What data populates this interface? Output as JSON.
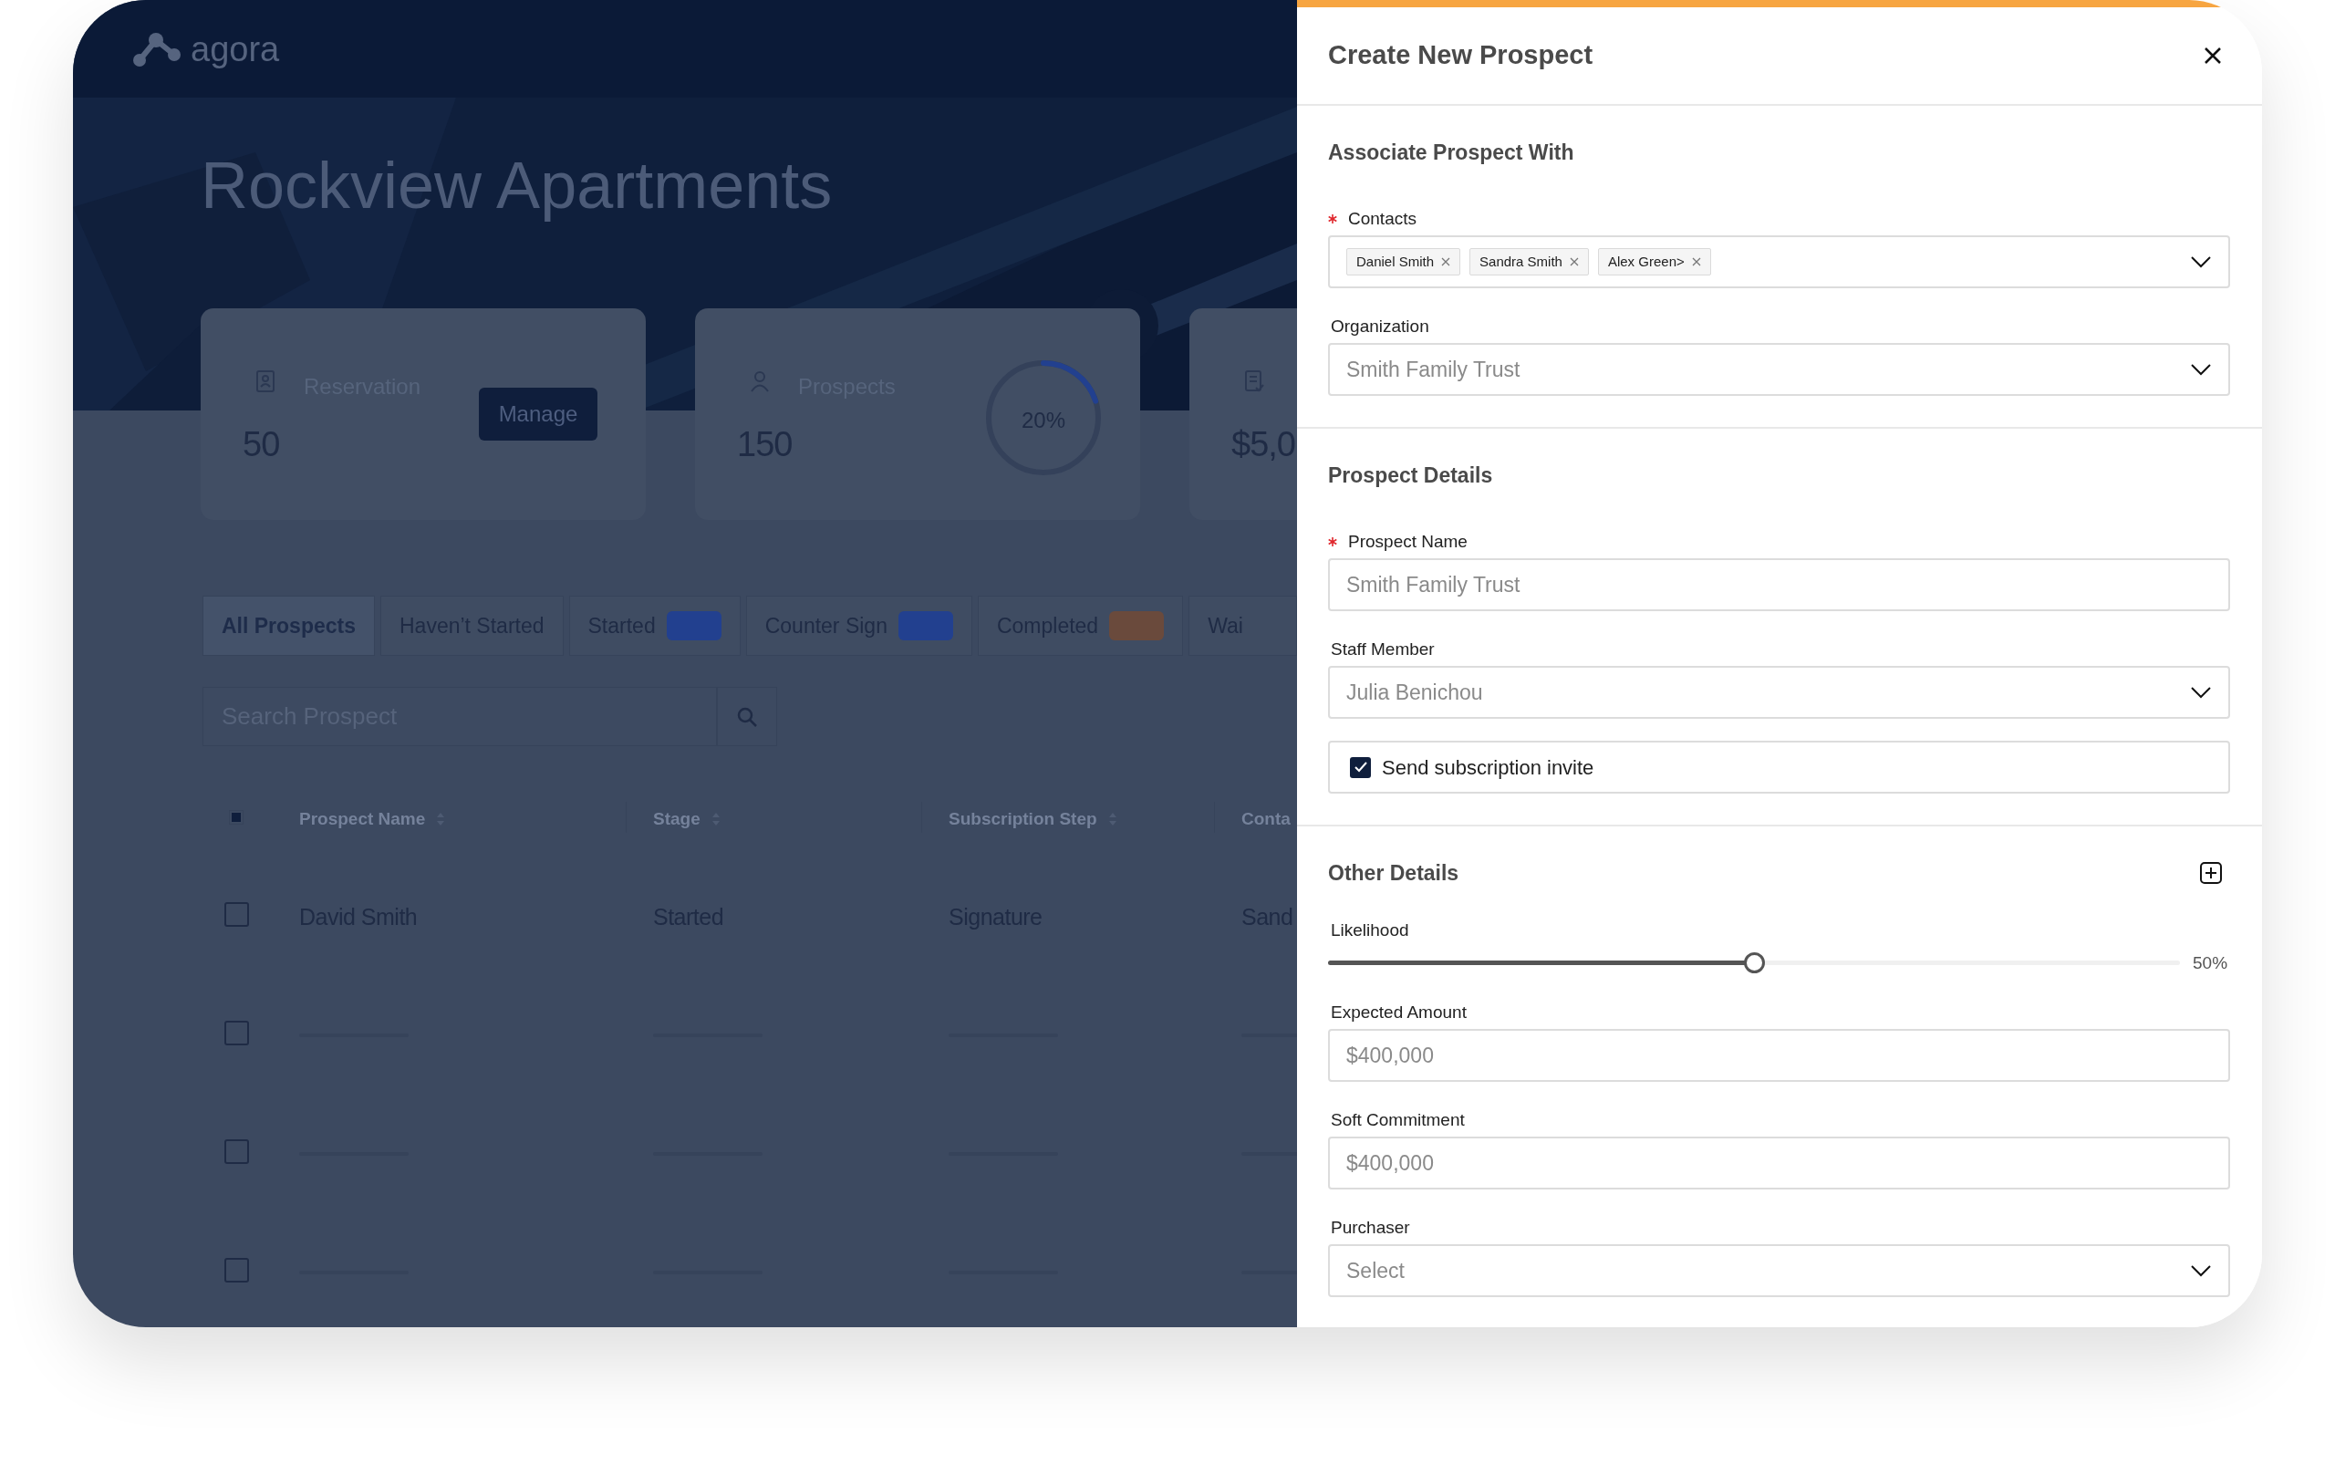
{
  "app": {
    "logo": "agora"
  },
  "hero": {
    "title": "Rockview Apartments"
  },
  "stat_cards": [
    {
      "kind": "button",
      "label": "Reservation",
      "value": "50",
      "button": "Manage"
    },
    {
      "kind": "ring",
      "label": "Prospects",
      "value": "150",
      "level": 0.2,
      "reading": "20%"
    },
    {
      "kind": "plain",
      "value": "$5,0"
    }
  ],
  "tabs": [
    {
      "label": "All Prospects",
      "selected": true
    },
    {
      "label": "Haven’t Started",
      "selected": false
    },
    {
      "label": "Started",
      "selected": false,
      "color": "#22408f"
    },
    {
      "label": "Counter Sign",
      "selected": false,
      "color": "#22408f"
    },
    {
      "label": "Completed",
      "selected": false,
      "color": "#6a4a3c"
    },
    {
      "label": "Wai",
      "selected": false
    }
  ],
  "search": {
    "placeholder": "Search Prospect"
  },
  "table": {
    "select_all": {
      "indeterminate": true
    },
    "columns": [
      "Prospect Name",
      "Stage",
      "Subscription Step",
      "Conta"
    ],
    "rows": [
      {
        "kind": "text",
        "checked": false,
        "cells": [
          "David Smith",
          "Started",
          "Signature",
          "Sand"
        ]
      },
      {
        "kind": "placeholder",
        "checked": false
      },
      {
        "kind": "placeholder",
        "checked": false
      },
      {
        "kind": "placeholder",
        "checked": false
      }
    ]
  },
  "panel": {
    "title": "Create New Prospect",
    "sections": [
      {
        "title": "Associate Prospect With",
        "fields": [
          {
            "kind": "tags",
            "label": "Contacts",
            "required": true,
            "tags": [
              "Daniel Smith",
              "Sandra Smith",
              "Alex Green>"
            ]
          },
          {
            "kind": "select",
            "label": "Organization",
            "required": false,
            "value": "Smith Family Trust"
          }
        ]
      },
      {
        "title": "Prospect Details",
        "fields": [
          {
            "kind": "text",
            "label": "Prospect Name",
            "required": true,
            "value": "Smith Family Trust"
          },
          {
            "kind": "select",
            "label": "Staff Member",
            "required": false,
            "value": "Julia Benichou"
          },
          {
            "kind": "checkbox",
            "label": "Send subscription invite",
            "checked": true
          }
        ]
      },
      {
        "title": "Other Details",
        "addable": true,
        "fields": [
          {
            "kind": "slider",
            "label": "Likelihood",
            "level": 0.5,
            "reading": "50%"
          },
          {
            "kind": "text",
            "label": "Expected Amount",
            "required": false,
            "value": "$400,000"
          },
          {
            "kind": "text",
            "label": "Soft Commitment",
            "required": false,
            "value": "$400,000"
          },
          {
            "kind": "select",
            "label": "Purchaser",
            "required": false,
            "placeholder": "Select"
          }
        ]
      }
    ]
  }
}
